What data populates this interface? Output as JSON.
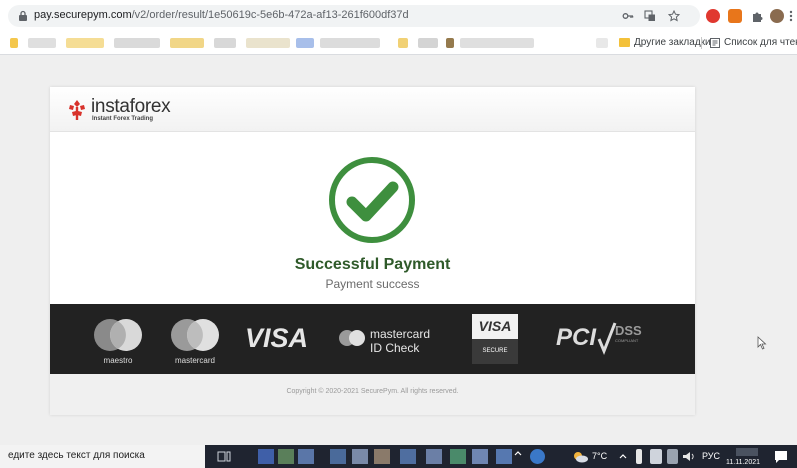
{
  "browser": {
    "url_host": "pay.securepym.com",
    "url_path": "/v2/order/result/1e50619c-5e6b-472a-af13-261f600df37d",
    "bookmarks": {
      "other": "Другие закладки",
      "reading_list": "Список для чтения"
    }
  },
  "brand": {
    "name": "instaforex",
    "tagline": "Instant Forex Trading",
    "accent": "#d8322b"
  },
  "result": {
    "title": "Successful Payment",
    "subtitle": "Payment success",
    "check_color": "#3e8f3e"
  },
  "payment_logos": {
    "maestro": "maestro",
    "mastercard": "mastercard",
    "visa": "VISA",
    "mc_id_check_line1": "mastercard",
    "mc_id_check_line2": "ID Check",
    "visa_secure_top": "VISA",
    "visa_secure_bottom": "SECURE",
    "pci": "PCI",
    "dss": "DSS",
    "dss_sub": "COMPLIANT"
  },
  "footer": {
    "copyright": "Copyright © 2020-2021 SecurePym. All rights reserved."
  },
  "taskbar": {
    "search_placeholder": "едите здесь текст для поиска",
    "temperature": "7°C",
    "lang": "РУС",
    "date": "11.11.2021"
  }
}
